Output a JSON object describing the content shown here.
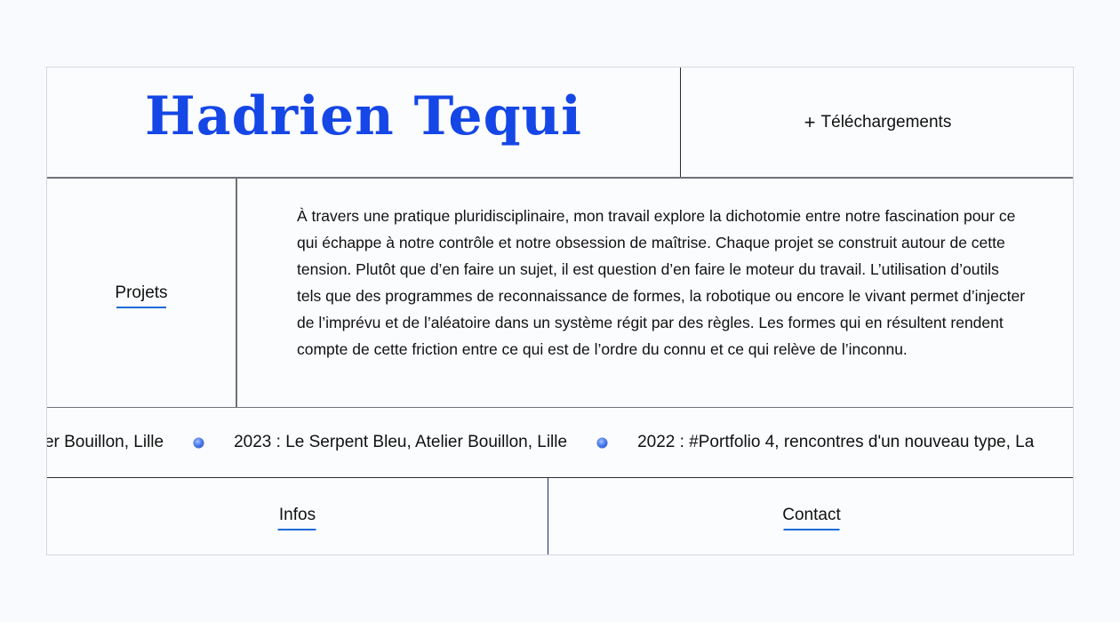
{
  "header": {
    "title": "Hadrien Tequi",
    "downloads_label": "Téléchargements",
    "downloads_icon": "plus-icon"
  },
  "nav": {
    "projects_label": "Projets",
    "infos_label": "Infos",
    "contact_label": "Contact"
  },
  "bio": {
    "text": "À travers une pratique pluridisciplinaire, mon travail explore la dichotomie entre notre fascination pour ce qui échappe à notre contrôle et notre obsession de maîtrise. Chaque projet se construit autour de cette tension. Plutôt que d’en faire un sujet, il est question d’en faire le moteur du travail. L’utilisation d’outils tels que des programmes de reconnaissance de formes, la robotique ou encore le vivant permet d’injecter de l’imprévu et de l’aléatoire dans un système régit par des règles. Les formes qui en résultent rendent compte de cette friction entre ce qui est de l’ordre du connu et ce qui relève de l’inconnu."
  },
  "ticker": {
    "items": [
      "Atelier Bouillon, Lille",
      "2023 : Le Serpent Bleu, Atelier Bouillon, Lille",
      "2022 : #Portfolio 4, rencontres d'un nouveau type, La"
    ],
    "bullet_icon": "blue-dot-icon"
  },
  "colors": {
    "accent": "#1546e6",
    "underline": "#1a6bd8",
    "background": "#f8fafd"
  }
}
